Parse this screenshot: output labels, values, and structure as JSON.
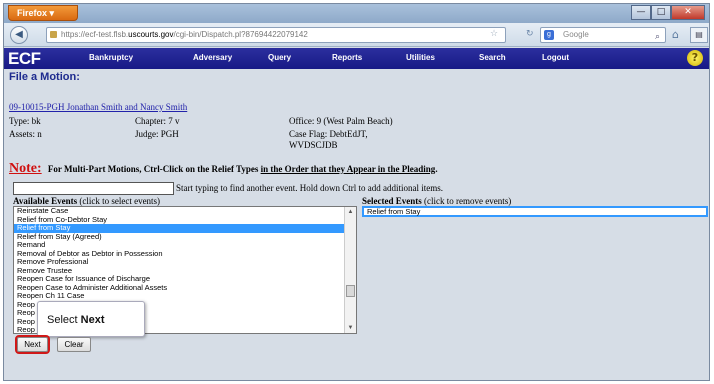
{
  "browser": {
    "app_button": "Firefox ▾",
    "url_prefix": "https://ecf-test.flsb.",
    "url_domain": "uscourts.gov",
    "url_path": "/cgi-bin/Dispatch.pl?87694422079142",
    "search_placeholder": "Google",
    "controls": {
      "minimize": "—",
      "maximize": "□",
      "close": "✕"
    }
  },
  "ecf_menu": {
    "logo": "ECF",
    "items": [
      "Bankruptcy",
      "Adversary",
      "Query",
      "Reports",
      "Utilities",
      "Search",
      "Logout"
    ]
  },
  "page": {
    "title": "File a Motion:",
    "case_link": "09-10015-PGH Jonathan Smith and Nancy Smith",
    "info": {
      "type": "Type: bk",
      "chapter": "Chapter: 7 v",
      "office": "Office: 9 (West Palm Beach)",
      "assets": "Assets: n",
      "judge": "Judge: PGH",
      "case_flag_1": "Case Flag: DebtEdJT,",
      "case_flag_2": "WVDSCJDB"
    },
    "note": {
      "label": "Note:",
      "text_a": "For Multi-Part Motions, Ctrl-Click on the Relief Types",
      "text_under": "in the Order that they Appear in the Pleading",
      "text_b": "."
    },
    "event_hint": "Start typing to find another event. Hold down Ctrl to add additional items.",
    "available_label": "Available Events",
    "available_hint": "(click to select events)",
    "selected_label": "Selected Events",
    "selected_hint": "(click to remove events)",
    "available_events": [
      "Reinstate Case",
      "Relief from Co-Debtor Stay",
      "Relief from Stay",
      "Relief from Stay (Agreed)",
      "Remand",
      "Removal of Debtor as Debtor in Possession",
      "Remove Professional",
      "Remove Trustee",
      "Reopen Case for Issuance of Discharge",
      "Reopen Case to Administer Additional Assets",
      "Reopen Ch 11 Case",
      "Reop",
      "Reop",
      "Reop",
      "Reop"
    ],
    "available_selected_index": 2,
    "selected_events": [
      "Relief from Stay"
    ],
    "tooltip_prefix": "Select",
    "tooltip_bold": "Next",
    "next_button": "Next",
    "clear_button": "Clear"
  },
  "colors": {
    "header_blue": "#1e1f8f",
    "note_red": "#d01010",
    "selection_blue": "#3399ff",
    "highlight_red": "#d01818"
  },
  "icons": [
    "back-arrow-icon",
    "lock-icon",
    "star-icon",
    "reload-icon",
    "search-engine-icon",
    "search-icon",
    "home-icon",
    "menu-icon",
    "help-icon"
  ]
}
